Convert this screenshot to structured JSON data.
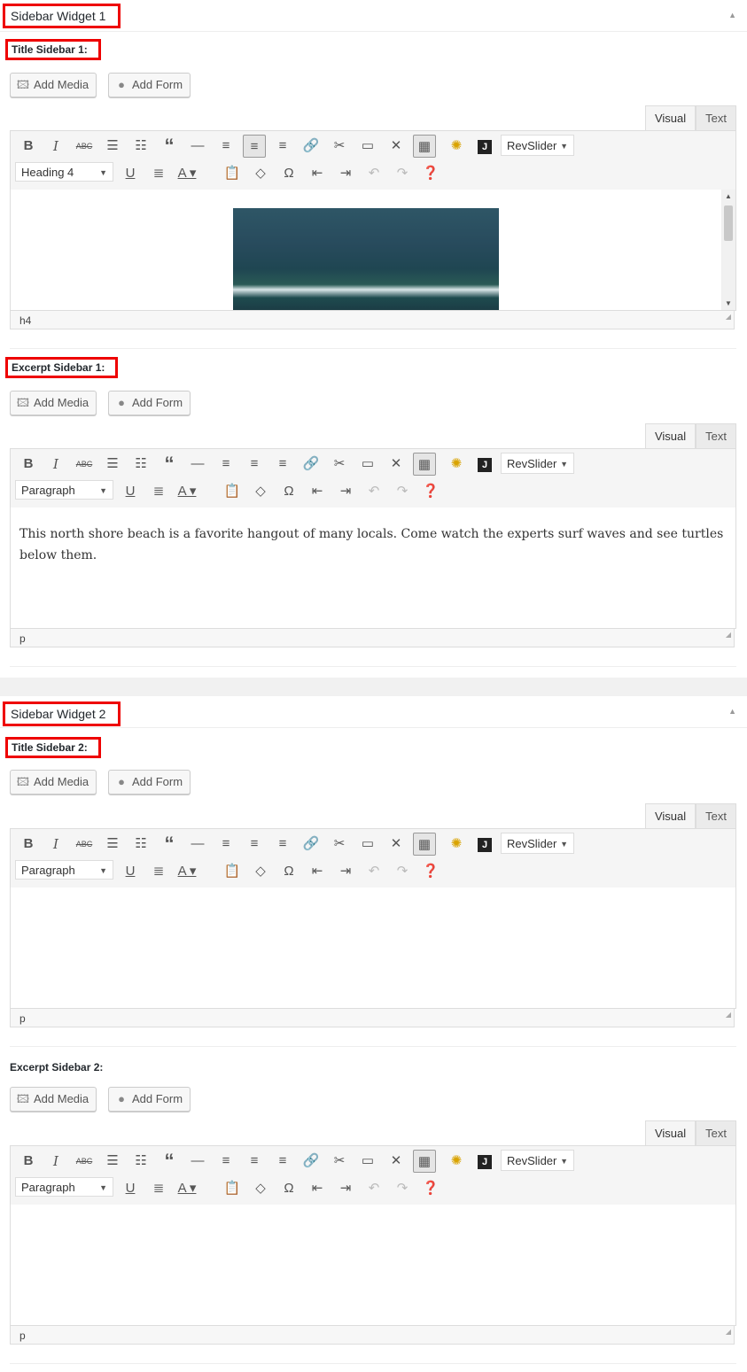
{
  "widget1": {
    "title": "Sidebar Widget 1",
    "title_field": {
      "label": "Title Sidebar 1:",
      "format": "Heading 4",
      "status_path": "h4"
    },
    "excerpt_field": {
      "label": "Excerpt Sidebar 1:",
      "format": "Paragraph",
      "status_path": "p",
      "content": "This north shore beach is a favorite hangout of many locals.   Come watch the experts surf waves and see turtles below them."
    }
  },
  "widget2": {
    "title": "Sidebar Widget 2",
    "title_field": {
      "label": "Title Sidebar 2:",
      "format": "Paragraph",
      "status_path": "p"
    },
    "excerpt_field": {
      "label": "Excerpt Sidebar 2:",
      "format": "Paragraph",
      "status_path": "p"
    }
  },
  "buttons": {
    "add_media": "Add Media",
    "add_form": "Add Form"
  },
  "tabs": {
    "visual": "Visual",
    "text": "Text"
  },
  "toolbar": {
    "revslider": "RevSlider",
    "row1_icons": [
      "bold-icon",
      "italic-icon",
      "strikethrough-icon",
      "bullet-list-icon",
      "numbered-list-icon",
      "blockquote-icon",
      "horizontal-rule-icon",
      "align-left-icon",
      "align-center-icon",
      "align-right-icon",
      "link-icon",
      "unlink-icon",
      "read-more-icon",
      "fullscreen-icon",
      "toolbar-toggle-icon",
      "plugin-icon",
      "j-icon"
    ],
    "row2_icons": [
      "underline-icon",
      "justify-icon",
      "text-color-icon",
      "paste-text-icon",
      "clear-formatting-icon",
      "special-character-icon",
      "outdent-icon",
      "indent-icon",
      "undo-icon",
      "redo-icon",
      "help-icon"
    ]
  },
  "image": {
    "icon": "surf-photo"
  },
  "colors": {
    "highlight_border": "#ee0000",
    "toolbar_bg": "#f5f5f5"
  }
}
